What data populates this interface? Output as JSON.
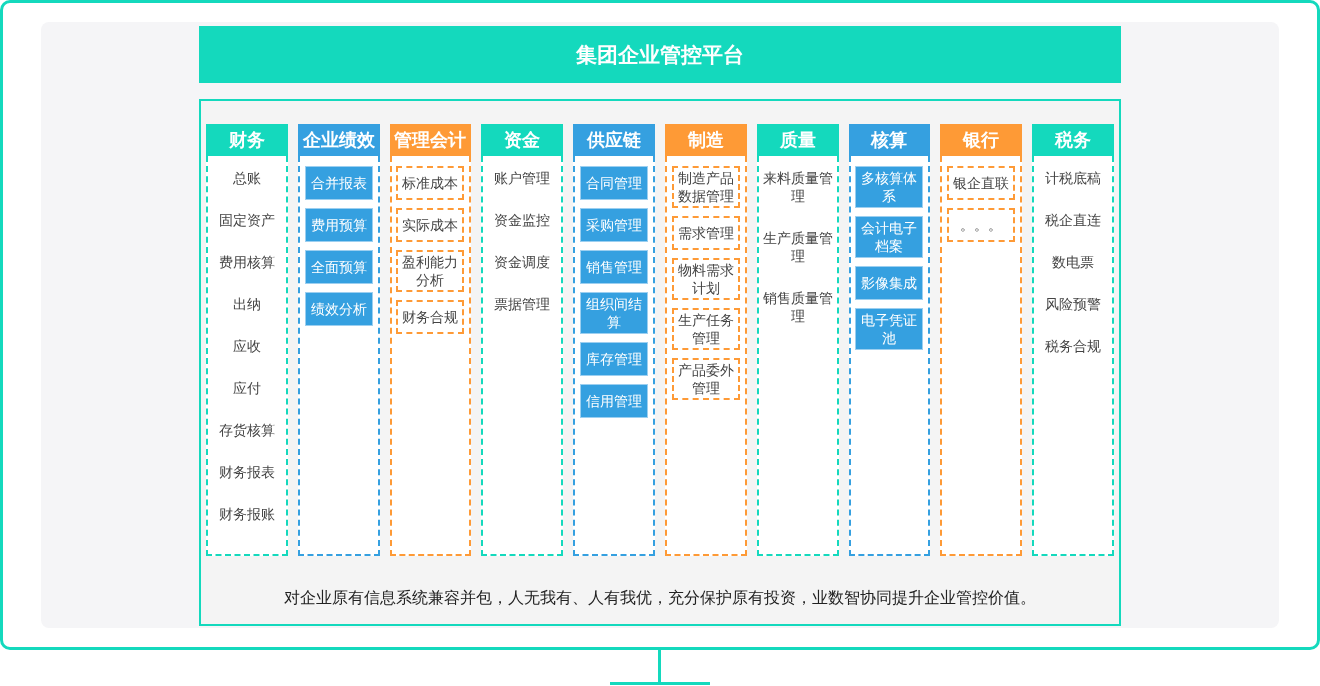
{
  "title": "集团企业管控平台",
  "columns": [
    {
      "title": "财务",
      "color": "#14d9bd",
      "kind": "plain",
      "items": [
        "总账",
        "固定资产",
        "费用核算",
        "出纳",
        "应收",
        "应付",
        "存货核算",
        "财务报表",
        "财务报账"
      ]
    },
    {
      "title": "企业绩效",
      "color": "#35a0e0",
      "kind": "filled",
      "items": [
        "合并报表",
        "费用预算",
        "全面预算",
        "绩效分析"
      ]
    },
    {
      "title": "管理会计",
      "color": "#fe9a36",
      "kind": "dashed",
      "items": [
        "标准成本",
        "实际成本",
        "盈利能力分析",
        "财务合规"
      ]
    },
    {
      "title": "资金",
      "color": "#14d9bd",
      "kind": "plain",
      "items": [
        "账户管理",
        "资金监控",
        "资金调度",
        "票据管理"
      ]
    },
    {
      "title": "供应链",
      "color": "#35a0e0",
      "kind": "filled",
      "items": [
        "合同管理",
        "采购管理",
        "销售管理",
        "组织间结算",
        "库存管理",
        "信用管理"
      ]
    },
    {
      "title": "制造",
      "color": "#fe9a36",
      "kind": "dashed",
      "items": [
        "制造产品数据管理",
        "需求管理",
        "物料需求计划",
        "生产任务管理",
        "产品委外管理"
      ]
    },
    {
      "title": "质量",
      "color": "#14d9bd",
      "kind": "plain",
      "items": [
        "来料质量管理",
        "生产质量管理",
        "销售质量管理"
      ]
    },
    {
      "title": "核算",
      "color": "#35a0e0",
      "kind": "filled",
      "items": [
        "多核算体系",
        "会计电子档案",
        "影像集成",
        "电子凭证池"
      ]
    },
    {
      "title": "银行",
      "color": "#fe9a36",
      "kind": "dashed",
      "items": [
        "银企直联",
        "。。。"
      ]
    },
    {
      "title": "税务",
      "color": "#14d9bd",
      "kind": "plain",
      "items": [
        "计税底稿",
        "税企直连",
        "数电票",
        "风险预警",
        "税务合规"
      ]
    }
  ],
  "footer": "对企业原有信息系统兼容并包，人无我有、人有我优，充分保护原有投资，业数智协同提升企业管控价值。"
}
